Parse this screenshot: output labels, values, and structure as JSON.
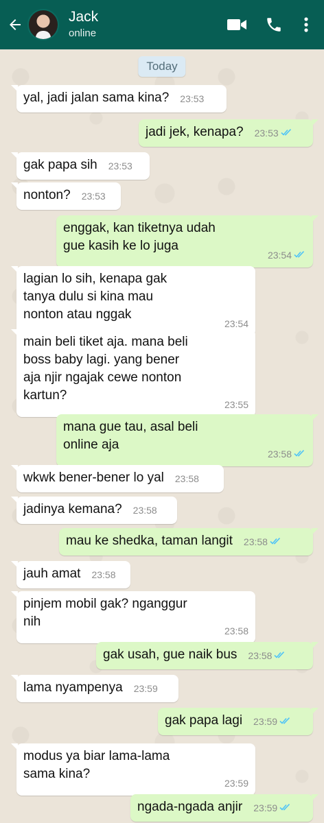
{
  "header": {
    "name": "Jack",
    "status": "online",
    "icons": [
      "back-arrow-icon",
      "video-call-icon",
      "phone-icon",
      "more-vert-icon"
    ],
    "background": "#075e54"
  },
  "chat": {
    "date_label": "Today",
    "colors": {
      "incoming": "#ffffff",
      "outgoing": "#dcf8c6",
      "read_ticks": "#4fc3f7"
    },
    "messages": [
      {
        "dir": "in",
        "text": "yal, jadi jalan sama kina?",
        "time": "23:53"
      },
      {
        "dir": "out",
        "text": "jadi jek, kenapa?",
        "time": "23:53"
      },
      {
        "dir": "in",
        "text": "gak papa sih",
        "time": "23:53"
      },
      {
        "dir": "in",
        "text": "nonton?",
        "time": "23:53"
      },
      {
        "dir": "out",
        "text": "enggak, kan tiketnya udah gue kasih ke lo juga",
        "time": "23:54"
      },
      {
        "dir": "in",
        "text": "lagian lo sih, kenapa gak tanya dulu si kina mau nonton atau nggak",
        "time": "23:54"
      },
      {
        "dir": "in",
        "text": "main beli tiket aja. mana beli boss baby lagi. yang bener aja njir ngajak cewe nonton kartun?",
        "time": "23:55"
      },
      {
        "dir": "out",
        "text": "mana gue tau, asal beli online aja",
        "time": "23:58"
      },
      {
        "dir": "in",
        "text": "wkwk bener-bener lo yal",
        "time": "23:58"
      },
      {
        "dir": "in",
        "text": "jadinya kemana?",
        "time": "23:58"
      },
      {
        "dir": "out",
        "text": "mau ke shedka, taman langit",
        "time": "23:58"
      },
      {
        "dir": "in",
        "text": "jauh amat",
        "time": "23:58"
      },
      {
        "dir": "in",
        "text": "pinjem mobil gak? nganggur nih",
        "time": "23:58"
      },
      {
        "dir": "out",
        "text": "gak usah, gue naik bus",
        "time": "23:58"
      },
      {
        "dir": "in",
        "text": "lama nyampenya",
        "time": "23:59"
      },
      {
        "dir": "out",
        "text": "gak papa lagi",
        "time": "23:59"
      },
      {
        "dir": "in",
        "text": "modus ya biar lama-lama sama kina?",
        "time": "23:59"
      },
      {
        "dir": "out",
        "text": "ngada-ngada anjir",
        "time": "23:59"
      }
    ]
  }
}
